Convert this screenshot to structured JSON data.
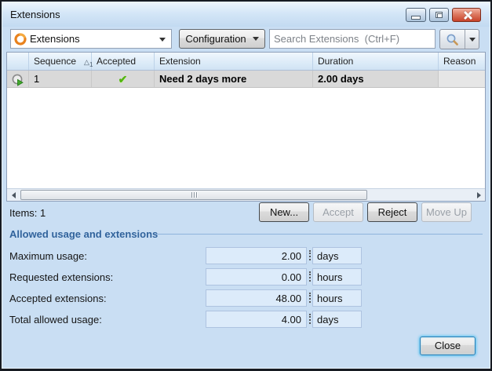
{
  "window": {
    "title": "Extensions"
  },
  "toolbar": {
    "view_selector_value": "Extensions",
    "configuration_label": "Configuration",
    "search_placeholder": "Search Extensions  (Ctrl+F)"
  },
  "grid": {
    "columns": {
      "sequence": "Sequence",
      "accepted": "Accepted",
      "extension": "Extension",
      "duration": "Duration",
      "reason": "Reason"
    },
    "sort": {
      "glyph": "△",
      "order": "1"
    },
    "row": {
      "sequence": "1",
      "accepted_glyph": "✔",
      "extension": "Need 2 days more",
      "duration": "2.00 days",
      "reason": ""
    }
  },
  "status": {
    "items": "Items: 1"
  },
  "actions": {
    "new": "New...",
    "accept": "Accept",
    "reject": "Reject",
    "move_up": "Move Up"
  },
  "usage": {
    "title": "Allowed usage and extensions",
    "fields": [
      {
        "label": "Maximum usage:",
        "value": "2.00",
        "unit": "days"
      },
      {
        "label": "Requested extensions:",
        "value": "0.00",
        "unit": "hours"
      },
      {
        "label": "Accepted extensions:",
        "value": "48.00",
        "unit": "hours"
      },
      {
        "label": "Total allowed usage:",
        "value": "4.00",
        "unit": "days"
      }
    ]
  },
  "footer": {
    "close": "Close"
  },
  "colors": {
    "accent_orange": "#f08019",
    "check_green": "#54b511",
    "section_title_blue": "#31639c",
    "selected_row_gray": "#d9d9d9",
    "close_glow_blue": "#55c3f0",
    "titlebar_close_red": "#c8432a"
  }
}
